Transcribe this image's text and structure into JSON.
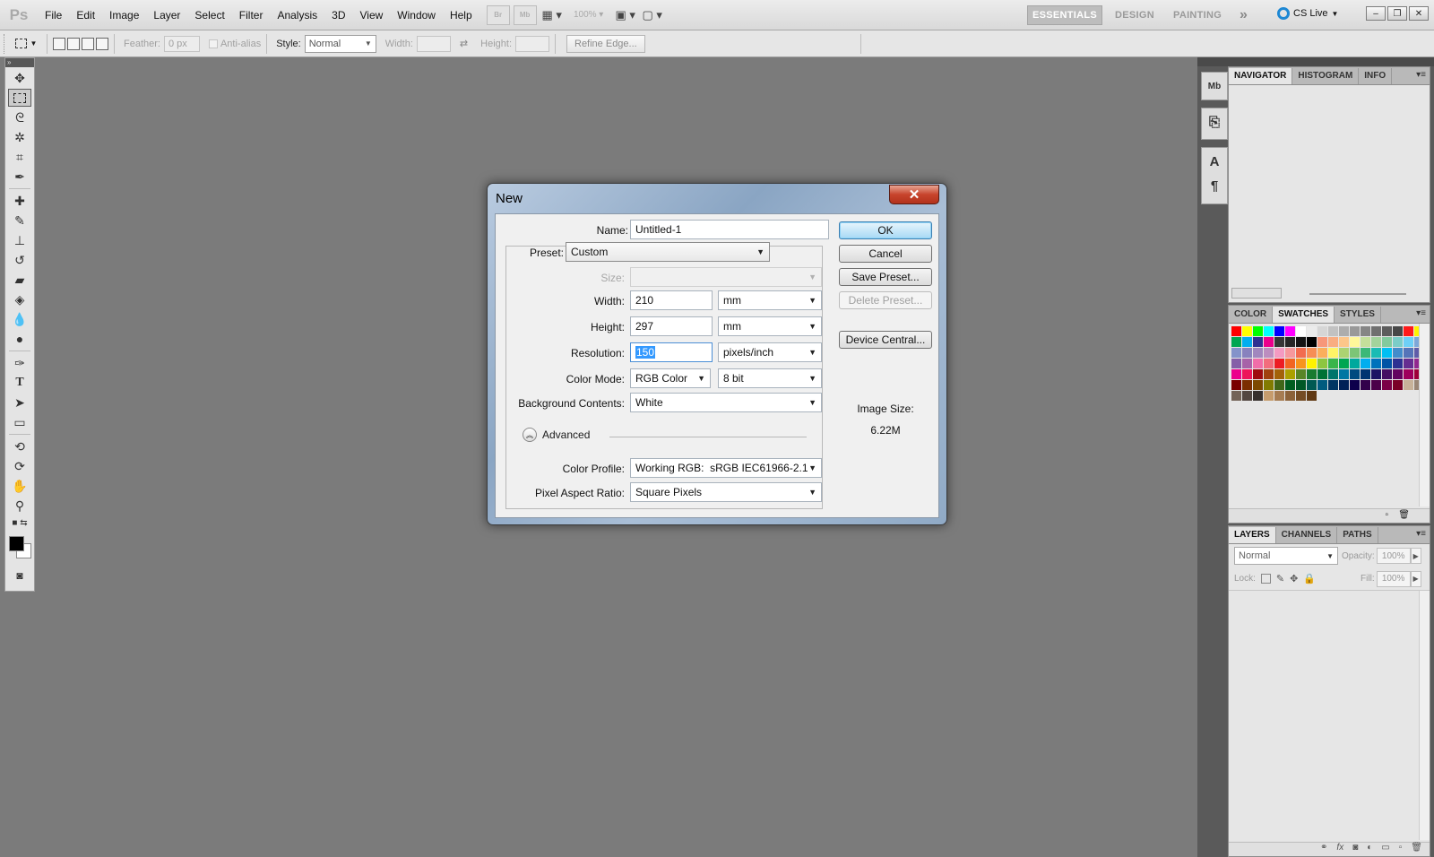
{
  "app": {
    "logo": "Ps"
  },
  "menu": [
    "File",
    "Edit",
    "Image",
    "Layer",
    "Select",
    "Filter",
    "Analysis",
    "3D",
    "View",
    "Window",
    "Help"
  ],
  "menubar": {
    "bridge": "Br",
    "minibridge": "Mb",
    "zoom": "100%"
  },
  "workspaces": {
    "essentials": "ESSENTIALS",
    "design": "DESIGN",
    "painting": "PAINTING",
    "more": "»",
    "cslive": "CS Live"
  },
  "window_controls": {
    "minimize": "–",
    "restore": "❐",
    "close": "✕"
  },
  "options_bar": {
    "feather_label": "Feather:",
    "feather_value": "0 px",
    "antialias_label": "Anti-alias",
    "style_label": "Style:",
    "style_value": "Normal",
    "width_label": "Width:",
    "height_label": "Height:",
    "refine_edge": "Refine Edge..."
  },
  "dialog": {
    "title": "New",
    "close": "✕",
    "name_label": "Name:",
    "name_value": "Untitled-1",
    "preset_label": "Preset:",
    "preset_value": "Custom",
    "size_label": "Size:",
    "size_value": "",
    "width_label": "Width:",
    "width_value": "210",
    "width_unit": "mm",
    "height_label": "Height:",
    "height_value": "297",
    "height_unit": "mm",
    "resolution_label": "Resolution:",
    "resolution_value": "150",
    "resolution_unit": "pixels/inch",
    "color_mode_label": "Color Mode:",
    "color_mode_value": "RGB Color",
    "bit_depth": "8 bit",
    "background_label": "Background Contents:",
    "background_value": "White",
    "advanced_label": "Advanced",
    "color_profile_label": "Color Profile:",
    "color_profile_value": "Working RGB:  sRGB IEC61966-2.1",
    "pixel_aspect_label": "Pixel Aspect Ratio:",
    "pixel_aspect_value": "Square Pixels",
    "ok": "OK",
    "cancel": "Cancel",
    "save_preset": "Save Preset...",
    "delete_preset": "Delete Preset...",
    "device_central": "Device Central...",
    "image_size_label": "Image Size:",
    "image_size_value": "6.22M"
  },
  "panels": {
    "nav_tabs": [
      "NAVIGATOR",
      "HISTOGRAM",
      "INFO"
    ],
    "color_tabs": [
      "COLOR",
      "SWATCHES",
      "STYLES"
    ],
    "layer_tabs": [
      "LAYERS",
      "CHANNELS",
      "PATHS"
    ],
    "blend_mode": "Normal",
    "opacity_label": "Opacity:",
    "opacity_value": "100%",
    "lock_label": "Lock:",
    "fill_label": "Fill:",
    "fill_value": "100%"
  },
  "swatch_colors": [
    "#ff0000",
    "#ffff00",
    "#00ff00",
    "#00ffff",
    "#0000ff",
    "#ff00ff",
    "#ffffff",
    "#ebebeb",
    "#d6d6d6",
    "#c2c2c2",
    "#adadad",
    "#999999",
    "#858585",
    "#707070",
    "#5c5c5c",
    "#474747",
    "#ff1a1a",
    "#fff200",
    "#00a651",
    "#00aeef",
    "#2e3192",
    "#ec008c",
    "#363636",
    "#262626",
    "#141414",
    "#000000",
    "#f7977a",
    "#f9ad81",
    "#fdc68a",
    "#fff79a",
    "#c4df9b",
    "#a3d39c",
    "#82ca9d",
    "#7bcdc8",
    "#6ecff6",
    "#7ea7d8",
    "#8493ca",
    "#8882be",
    "#a187be",
    "#bc8dbf",
    "#f49ac2",
    "#f6989d",
    "#f26c4f",
    "#f68e55",
    "#fbaf5c",
    "#fff467",
    "#acd372",
    "#7cc576",
    "#3bb878",
    "#1abbb4",
    "#00bff3",
    "#438ccb",
    "#5574b9",
    "#605ca8",
    "#855fa8",
    "#a763a8",
    "#f06ea9",
    "#f26d7d",
    "#ed1c24",
    "#f26522",
    "#f7941d",
    "#fff200",
    "#8dc63f",
    "#39b54a",
    "#00a651",
    "#00a99d",
    "#00aeef",
    "#0072bc",
    "#0054a6",
    "#2e3192",
    "#662d91",
    "#92278f",
    "#ec008c",
    "#ed145b",
    "#9e0b0f",
    "#a0410d",
    "#a36209",
    "#aba000",
    "#598527",
    "#197b30",
    "#007236",
    "#00746b",
    "#0076a3",
    "#004b80",
    "#003471",
    "#1b1464",
    "#440e62",
    "#630460",
    "#9e005d",
    "#9e0039",
    "#790000",
    "#7b2e00",
    "#7d4900",
    "#827b00",
    "#406618",
    "#005e20",
    "#005826",
    "#005952",
    "#005b7f",
    "#003663",
    "#002157",
    "#0d004c",
    "#32004b",
    "#4b0049",
    "#7b0046",
    "#7a0026",
    "#c7b299",
    "#998675",
    "#736357",
    "#534741",
    "#37302d",
    "#c69c6d",
    "#a67c52",
    "#8c6239",
    "#754c24",
    "#603913"
  ]
}
